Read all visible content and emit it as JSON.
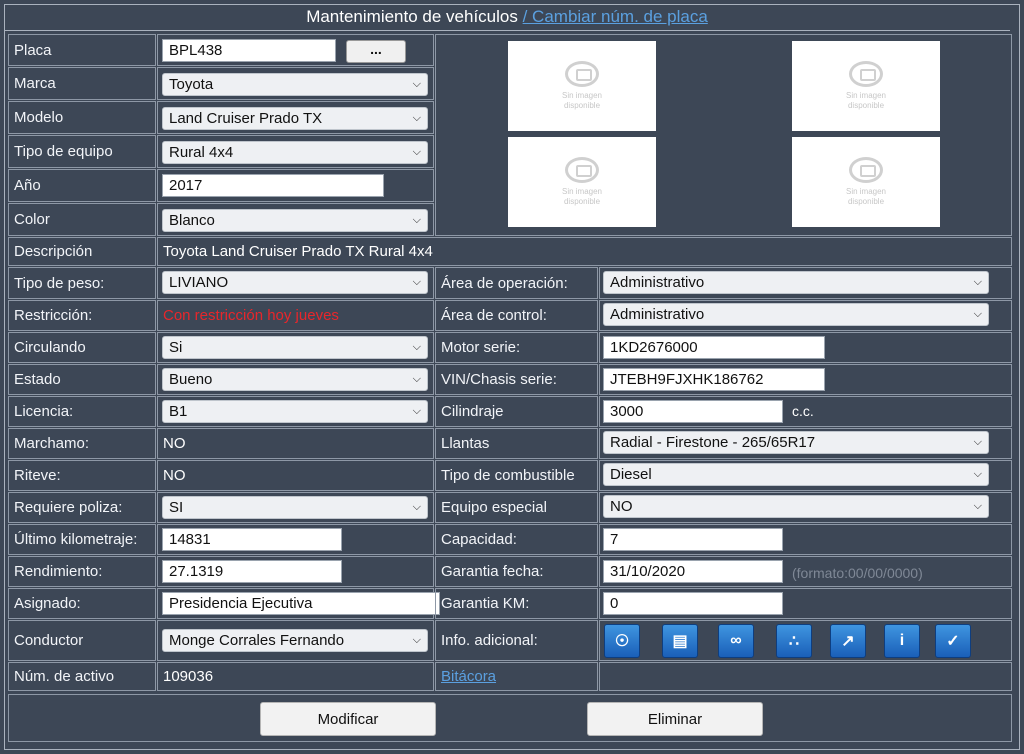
{
  "header": {
    "title": "Mantenimiento de vehículos",
    "link": "/  Cambiar núm. de placa"
  },
  "photos": {
    "placeholder_line1": "Sin imagen",
    "placeholder_line2": "disponible"
  },
  "left": {
    "placa": {
      "label": "Placa",
      "value": "BPL438",
      "button": "..."
    },
    "marca": {
      "label": "Marca",
      "value": "Toyota"
    },
    "modelo": {
      "label": "Modelo",
      "value": "Land Cruiser Prado TX"
    },
    "tipo_equipo": {
      "label": "Tipo de equipo",
      "value": "Rural 4x4"
    },
    "anio": {
      "label": "Año",
      "value": "2017"
    },
    "color": {
      "label": "Color",
      "value": "Blanco"
    },
    "descripcion": {
      "label": "Descripción",
      "value": "Toyota Land Cruiser Prado TX Rural 4x4"
    },
    "tipo_peso": {
      "label": "Tipo de peso:",
      "value": "LIVIANO"
    },
    "restriccion": {
      "label": "Restricción:",
      "value": "Con restricción hoy jueves"
    },
    "circulando": {
      "label": "Circulando",
      "value": "Si"
    },
    "estado": {
      "label": "Estado",
      "value": "Bueno"
    },
    "licencia": {
      "label": "Licencia:",
      "value": "B1"
    },
    "marchamo": {
      "label": "Marchamo:",
      "value": "NO"
    },
    "riteve": {
      "label": "Riteve:",
      "value": "NO"
    },
    "poliza": {
      "label": "Requiere poliza:",
      "value": "SI"
    },
    "km": {
      "label": "Último kilometraje:",
      "value": "14831"
    },
    "rendimiento": {
      "label": "Rendimiento:",
      "value": "27.1319"
    },
    "asignado": {
      "label": "Asignado:",
      "value": "Presidencia Ejecutiva"
    },
    "conductor": {
      "label": "Conductor",
      "value": "Monge Corrales Fernando"
    },
    "activo": {
      "label": "Núm. de activo",
      "value": "109036"
    }
  },
  "right": {
    "area_operacion": {
      "label": "Área de operación:",
      "value": "Administrativo"
    },
    "area_control": {
      "label": "Área de control:",
      "value": "Administrativo"
    },
    "motor": {
      "label": "Motor serie:",
      "value": "1KD2676000"
    },
    "vin": {
      "label": "VIN/Chasis serie:",
      "value": "JTEBH9FJXHK186762"
    },
    "cilindraje": {
      "label": "Cilindraje",
      "value": "3000",
      "unit": "c.c."
    },
    "llantas": {
      "label": "Llantas",
      "value": "Radial - Firestone - 265/65R17"
    },
    "combustible": {
      "label": "Tipo de combustible",
      "value": "Diesel"
    },
    "equipo_especial": {
      "label": "Equipo especial",
      "value": "NO"
    },
    "capacidad": {
      "label": "Capacidad:",
      "value": "7"
    },
    "garantia_fecha": {
      "label": "Garantia fecha:",
      "value": "31/10/2020",
      "hint": "(formato:00/00/0000)"
    },
    "garantia_km": {
      "label": "Garantia KM:",
      "value": "0"
    },
    "info": {
      "label": "Info. adicional:"
    },
    "bitacora": {
      "link": "Bitácora"
    }
  },
  "icons": [
    "globe-icon",
    "document-icon",
    "link-icon",
    "group-icon",
    "chart-icon",
    "info-icon",
    "check-icon"
  ],
  "actions": {
    "modificar": "Modificar",
    "eliminar": "Eliminar"
  }
}
